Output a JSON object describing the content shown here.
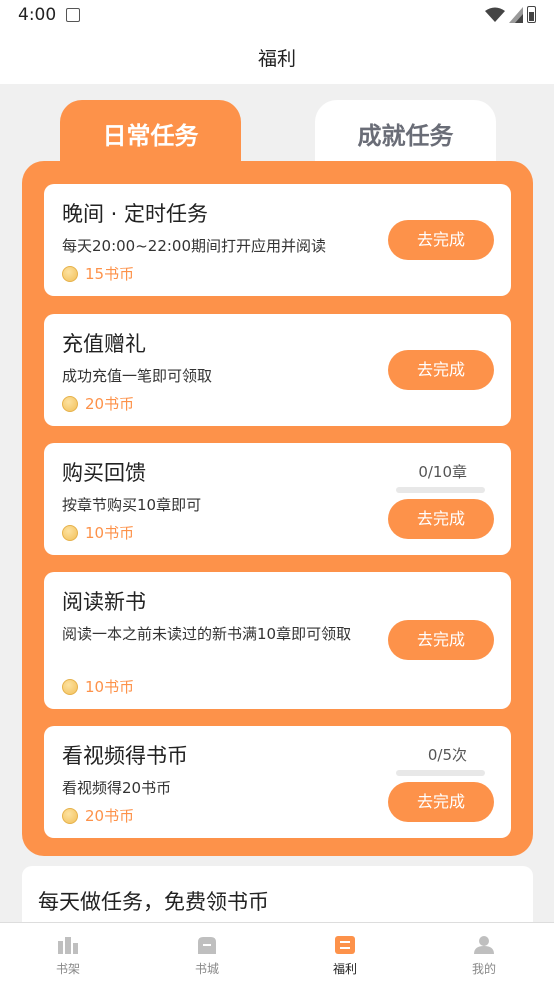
{
  "status_bar": {
    "time": "4:00"
  },
  "header": {
    "title": "福利"
  },
  "tabs": [
    {
      "label": "日常任务",
      "active": true
    },
    {
      "label": "成就任务",
      "active": false
    }
  ],
  "tasks": [
    {
      "title": "晚间 · 定时任务",
      "desc": "每天20:00~22:00期间打开应用并阅读",
      "reward": "15书币",
      "button": "去完成"
    },
    {
      "title": "充值赠礼",
      "desc": "成功充值一笔即可领取",
      "reward": "20书币",
      "button": "去完成"
    },
    {
      "title": "购买回馈",
      "desc": "按章节购买10章即可",
      "reward": "10书币",
      "button": "去完成",
      "progress_label": "0/10章",
      "progress": 0
    },
    {
      "title": "阅读新书",
      "desc": "阅读一本之前未读过的新书满10章即可领取",
      "reward": "10书币",
      "button": "去完成"
    },
    {
      "title": "看视频得书币",
      "desc": "看视频得20书币",
      "reward": "20书币",
      "button": "去完成",
      "progress_label": "0/5次",
      "progress": 0
    }
  ],
  "info": {
    "title": "每天做任务，免费领书币"
  },
  "bottom_nav": [
    {
      "label": "书架",
      "icon": "bookshelf-icon",
      "active": false
    },
    {
      "label": "书城",
      "icon": "bookstore-icon",
      "active": false
    },
    {
      "label": "福利",
      "icon": "welfare-icon",
      "active": true
    },
    {
      "label": "我的",
      "icon": "profile-icon",
      "active": false
    }
  ],
  "colors": {
    "accent": "#fd924a",
    "inactive_tab_text": "#6a6d77",
    "nav_inactive": "#bfbfbf"
  }
}
